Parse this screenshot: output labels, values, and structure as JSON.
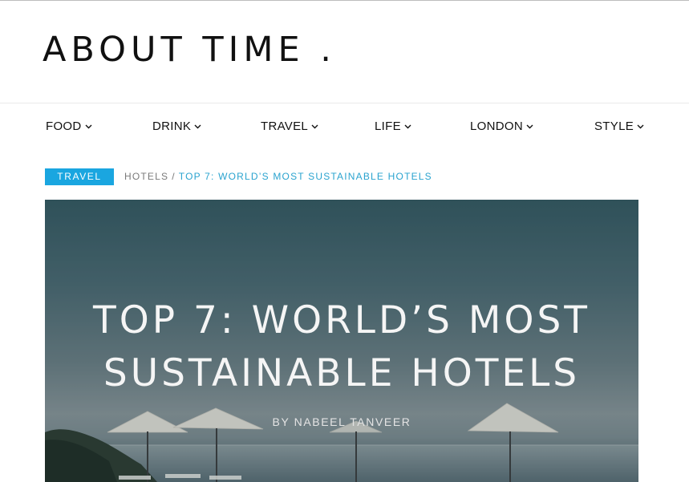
{
  "site": {
    "logo": "ABOUT TIME ."
  },
  "nav": {
    "items": [
      {
        "label": "FOOD"
      },
      {
        "label": "DRINK"
      },
      {
        "label": "TRAVEL"
      },
      {
        "label": "LIFE"
      },
      {
        "label": "LONDON"
      },
      {
        "label": "STYLE"
      }
    ],
    "icon": "chevron-down-icon"
  },
  "breadcrumb": {
    "category_tag": "TRAVEL",
    "parent": "HOTELS",
    "separator": "/",
    "current": "TOP 7: WORLD’S MOST SUSTAINABLE HOTELS"
  },
  "hero": {
    "title_line1": "TOP 7: WORLD’S MOST",
    "title_line2": "SUSTAINABLE HOTELS",
    "byline": "BY NABEEL TANVEER"
  },
  "colors": {
    "accent": "#1aa6e0",
    "breadcrumb_current": "#2aa3cf",
    "breadcrumb_link": "#7a7a7a"
  }
}
